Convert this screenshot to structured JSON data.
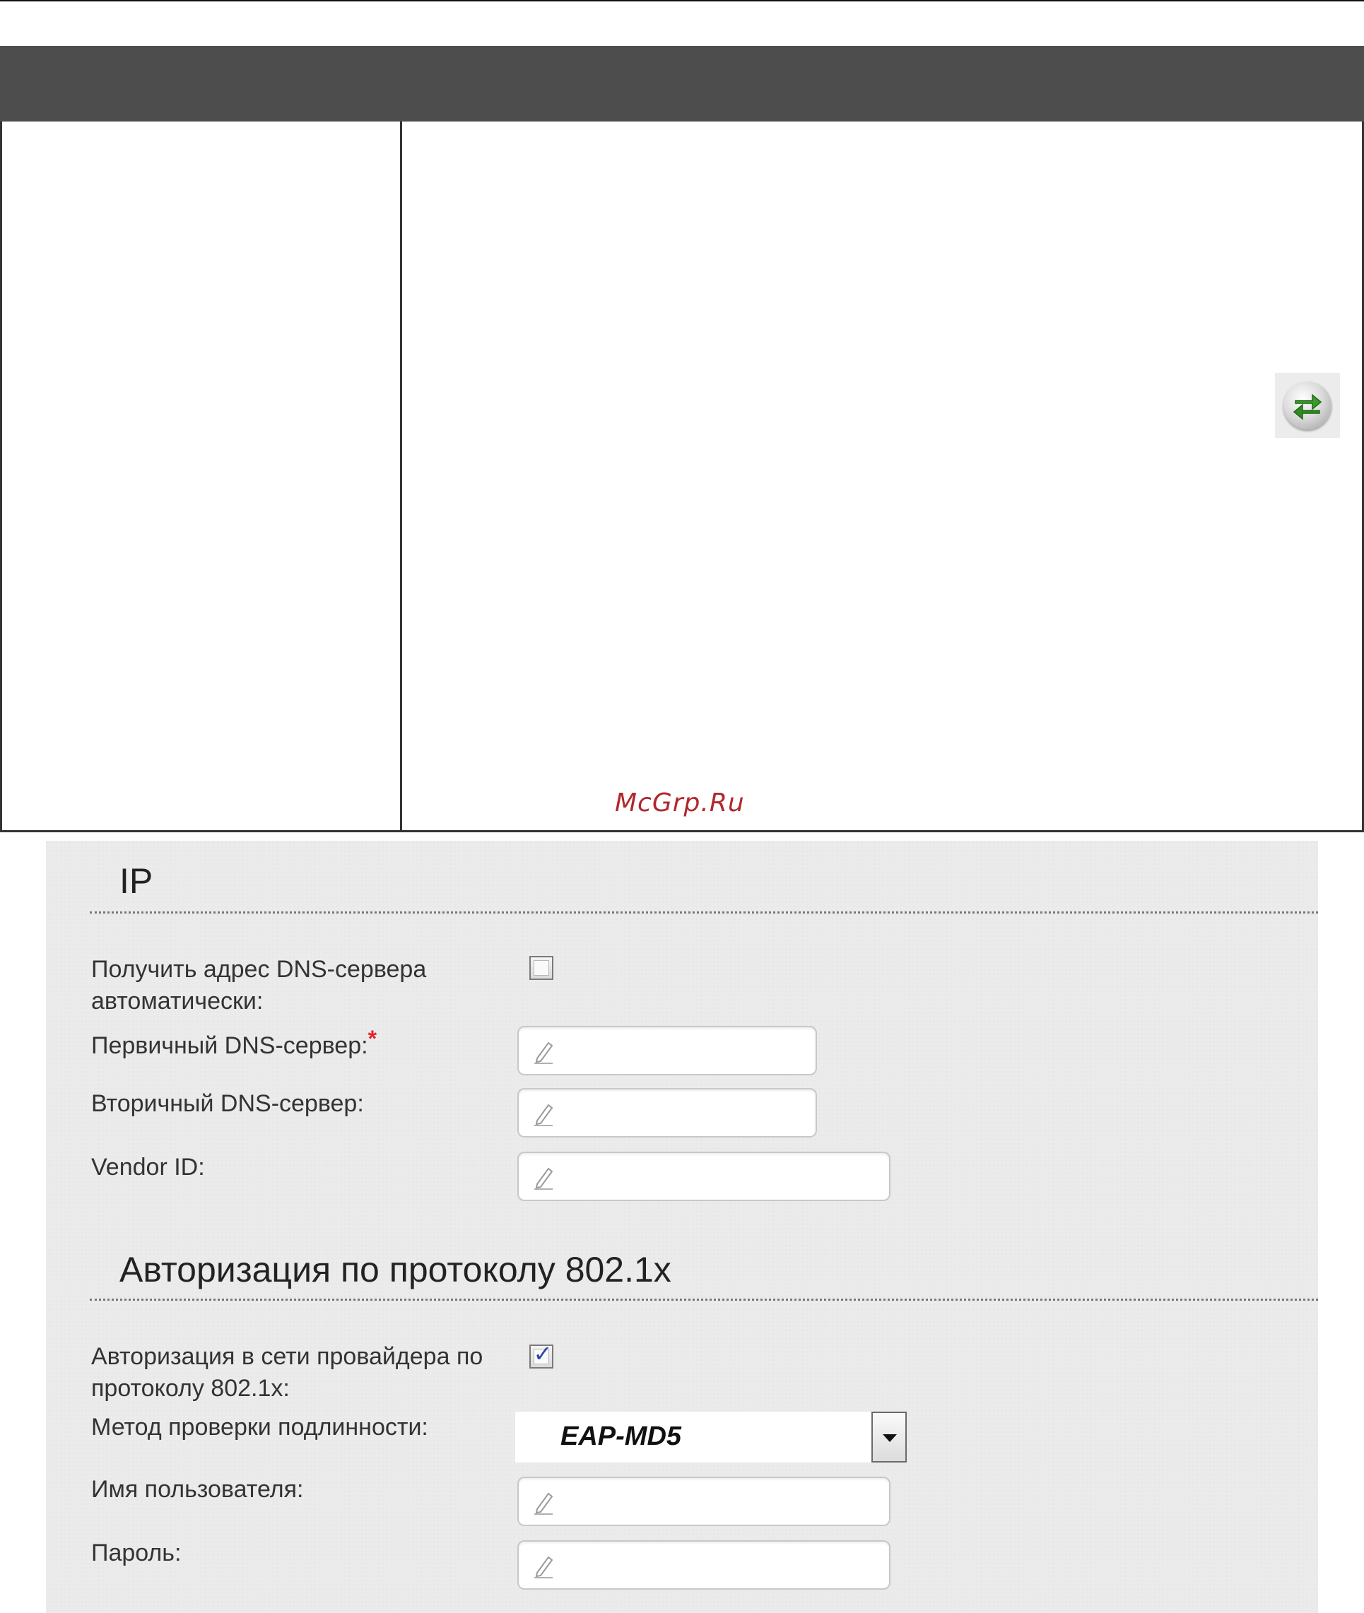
{
  "document": {
    "watermark": "McGrp.Ru"
  },
  "ip_section": {
    "title": "IP",
    "auto_dns": {
      "label_line1": "Получить адрес DNS-сервера",
      "label_line2": "автоматически:",
      "checked": false
    },
    "primary_dns": {
      "label": "Первичный DNS-сервер:",
      "required_mark": "*",
      "value": ""
    },
    "secondary_dns": {
      "label": "Вторичный DNS-сервер:",
      "value": ""
    },
    "vendor_id": {
      "label": "Vendor ID:",
      "value": ""
    }
  },
  "auth_section": {
    "title": "Авторизация по протоколу 802.1x",
    "enable_8021x": {
      "label_line1": "Авторизация в сети провайдера по",
      "label_line2": "протоколу 802.1x:",
      "checked": true
    },
    "auth_method": {
      "label": "Метод проверки подлинности:",
      "value": "EAP-MD5"
    },
    "username": {
      "label": "Имя пользователя:",
      "value": ""
    },
    "password": {
      "label": "Пароль:",
      "value": ""
    }
  },
  "icons": {
    "refresh": "refresh-arrows-icon",
    "pencil": "pencil-icon",
    "dropdown": "chevron-down-icon"
  },
  "colors": {
    "header_bar": "#4d4d4d",
    "panel_background": "#ebebeb",
    "required_star": "#e0262b",
    "watermark": "#b1282d",
    "checkmark": "#2a45a8",
    "refresh_arrows": "#3a9a2a"
  }
}
